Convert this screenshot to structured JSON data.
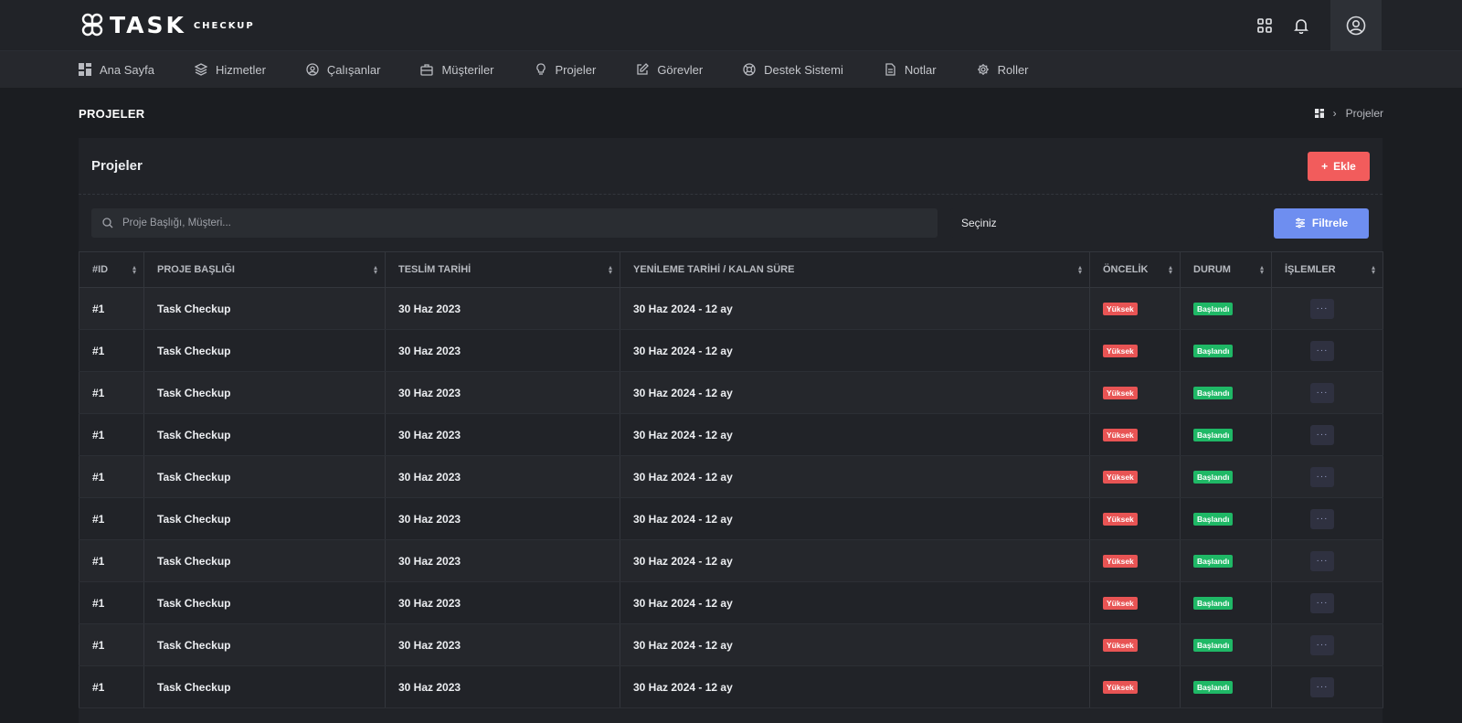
{
  "brand": {
    "name": "TASK",
    "sub": "CHECKUP"
  },
  "nav": [
    {
      "label": "Ana Sayfa",
      "icon": "dashboard-icon"
    },
    {
      "label": "Hizmetler",
      "icon": "layers-icon"
    },
    {
      "label": "Çalışanlar",
      "icon": "user-circle-icon"
    },
    {
      "label": "Müşteriler",
      "icon": "briefcase-icon"
    },
    {
      "label": "Projeler",
      "icon": "lightbulb-icon"
    },
    {
      "label": "Görevler",
      "icon": "edit-icon"
    },
    {
      "label": "Destek Sistemi",
      "icon": "lifebuoy-icon"
    },
    {
      "label": "Notlar",
      "icon": "document-icon"
    },
    {
      "label": "Roller",
      "icon": "gear-icon"
    }
  ],
  "page": {
    "title": "PROJELER",
    "breadcrumb_current": "Projeler"
  },
  "card": {
    "title": "Projeler",
    "add_label": "Ekle",
    "search_placeholder": "Proje Başlığı, Müşteri...",
    "select_value": "Seçiniz",
    "filter_label": "Filtrele"
  },
  "table": {
    "columns": [
      "#ID",
      "PROJE BAŞLIĞI",
      "TESLİM TARİHİ",
      "YENİLEME TARİHİ / KALAN SÜRE",
      "ÖNCELİK",
      "DURUM",
      "İŞLEMLER"
    ],
    "rows": [
      {
        "id": "#1",
        "title": "Task Checkup",
        "due": "30 Haz 2023",
        "renew": "30 Haz 2024 - 12 ay",
        "priority": "Yüksek",
        "status": "Başlandı",
        "action": "···"
      },
      {
        "id": "#1",
        "title": "Task Checkup",
        "due": "30 Haz 2023",
        "renew": "30 Haz 2024 - 12 ay",
        "priority": "Yüksek",
        "status": "Başlandı",
        "action": "···"
      },
      {
        "id": "#1",
        "title": "Task Checkup",
        "due": "30 Haz 2023",
        "renew": "30 Haz 2024 - 12 ay",
        "priority": "Yüksek",
        "status": "Başlandı",
        "action": "···"
      },
      {
        "id": "#1",
        "title": "Task Checkup",
        "due": "30 Haz 2023",
        "renew": "30 Haz 2024 - 12 ay",
        "priority": "Yüksek",
        "status": "Başlandı",
        "action": "···"
      },
      {
        "id": "#1",
        "title": "Task Checkup",
        "due": "30 Haz 2023",
        "renew": "30 Haz 2024 - 12 ay",
        "priority": "Yüksek",
        "status": "Başlandı",
        "action": "···"
      },
      {
        "id": "#1",
        "title": "Task Checkup",
        "due": "30 Haz 2023",
        "renew": "30 Haz 2024 - 12 ay",
        "priority": "Yüksek",
        "status": "Başlandı",
        "action": "···"
      },
      {
        "id": "#1",
        "title": "Task Checkup",
        "due": "30 Haz 2023",
        "renew": "30 Haz 2024 - 12 ay",
        "priority": "Yüksek",
        "status": "Başlandı",
        "action": "···"
      },
      {
        "id": "#1",
        "title": "Task Checkup",
        "due": "30 Haz 2023",
        "renew": "30 Haz 2024 - 12 ay",
        "priority": "Yüksek",
        "status": "Başlandı",
        "action": "···"
      },
      {
        "id": "#1",
        "title": "Task Checkup",
        "due": "30 Haz 2023",
        "renew": "30 Haz 2024 - 12 ay",
        "priority": "Yüksek",
        "status": "Başlandı",
        "action": "···"
      },
      {
        "id": "#1",
        "title": "Task Checkup",
        "due": "30 Haz 2023",
        "renew": "30 Haz 2024 - 12 ay",
        "priority": "Yüksek",
        "status": "Başlandı",
        "action": "···"
      }
    ]
  },
  "colors": {
    "accent_red": "#f25c5c",
    "accent_blue": "#6e8ef0",
    "status_green": "#1fb866"
  }
}
